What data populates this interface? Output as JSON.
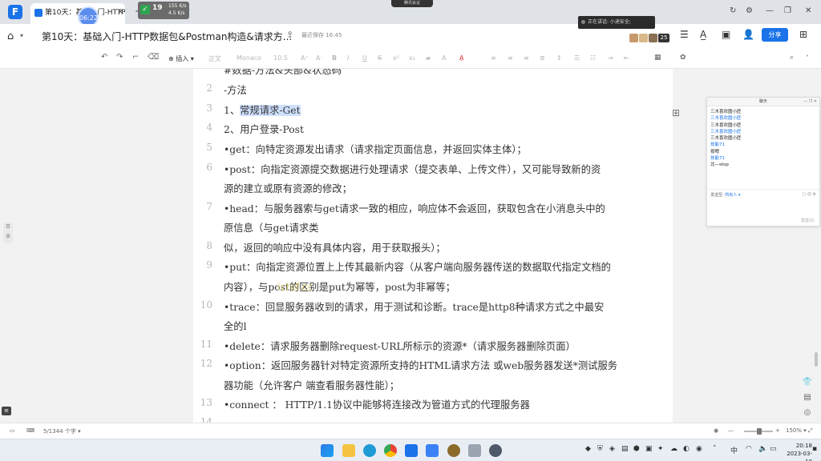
{
  "browser": {
    "tab_title": "第10天：基础入门-HTTP",
    "timer_badge": "06:22",
    "net_percent": "19",
    "net_up": "155 K/s",
    "net_down": "4.5 K/s",
    "meeting_label": "腾讯会议"
  },
  "doc": {
    "title": "第10天：基础入门-HTTP数据包&Postman构造&请求方...",
    "saved": "最近保存 16:45",
    "share_label": "分享",
    "camera_popup": "正在讲话: 小迪安全;",
    "collaborator_count": "25"
  },
  "toolbar": {
    "insert_label": "插入",
    "style_label": "正文",
    "font_label": "Monaco",
    "size_label": "10.5"
  },
  "content": {
    "lines": [
      {
        "num": "",
        "text": "#数据-方法&头部&状态码"
      },
      {
        "num": "2",
        "text": "-方法"
      },
      {
        "num": "3",
        "prefix": "1、",
        "highlight": "常规请求-Get"
      },
      {
        "num": "4",
        "text": "2、用户登录-Post"
      },
      {
        "num": "5",
        "text": "•get：向特定资源发出请求（请求指定页面信息，并返回实体主体）；"
      },
      {
        "num": "6",
        "text": "•post：向指定资源提交数据进行处理请求（提交表单、上传文件），又可能导致新的资"
      },
      {
        "num": "",
        "text": "源的建立或原有资源的修改；"
      },
      {
        "num": "7",
        "text": "•head：与服务器索与get请求一致的相应，响应体不会返回，获取包含在小消息头中的"
      },
      {
        "num": "",
        "text": "原信息（与get请求类"
      },
      {
        "num": "8",
        "text": "似，返回的响应中没有具体内容，用于获取报头）；"
      },
      {
        "num": "9",
        "text": "•put：向指定资源位置上上传其最新内容（从客户端向服务器传送的数据取代指定文档的"
      },
      {
        "num": "",
        "text": "内容），与post的区别是put为幂等，post为非幂等；"
      },
      {
        "num": "10",
        "text": "•trace：回显服务器收到的请求，用于测试和诊断。trace是http8种请求方式之中最安"
      },
      {
        "num": "",
        "text": "全的l"
      },
      {
        "num": "11",
        "text": "•delete：请求服务器删除request-URL所标示的资源*（请求服务器删除页面）"
      },
      {
        "num": "12",
        "text": "•option：返回服务器针对特定资源所支持的HTML请求方法 或web服务器发送*测试服务"
      },
      {
        "num": "",
        "text": "器功能（允许客户 端查看服务器性能）；"
      },
      {
        "num": "13",
        "text": "•connect ：  HTTP/1.1协议中能够将连接改为管道方式的代理服务器"
      },
      {
        "num": "14",
        "text": ""
      }
    ],
    "watermark": "ichif.cc"
  },
  "chat": {
    "title": "聊天",
    "messages": [
      {
        "text": "三木喜欢圆小匠",
        "color": "#222222"
      },
      {
        "text": "三木喜欢圆小匠",
        "color": "#1a73e8"
      },
      {
        "text": "三木喜欢圆小匠",
        "color": "#222222"
      },
      {
        "text": "三木喜欢圆小匠",
        "color": "#1a73e8"
      },
      {
        "text": "三木喜欢圆小匠",
        "color": "#222222"
      },
      {
        "text": "技能71",
        "color": "#1a73e8"
      },
      {
        "text": "按嗯",
        "color": "#222222"
      },
      {
        "text": "技能71",
        "color": "#1a73e8"
      },
      {
        "text": "北—stop",
        "color": "#222222"
      }
    ],
    "send_to_label": "发送至:",
    "send_to_value": "所有人",
    "send_button": "发送(S)"
  },
  "status": {
    "word_count": "5/1344 个字",
    "zoom": "150%"
  },
  "taskbar": {
    "time": "20:18",
    "date": "2023-03-10",
    "lang": "中"
  },
  "colors": {
    "accent": "#1a73e8",
    "highlight": "#cfe0ff"
  }
}
